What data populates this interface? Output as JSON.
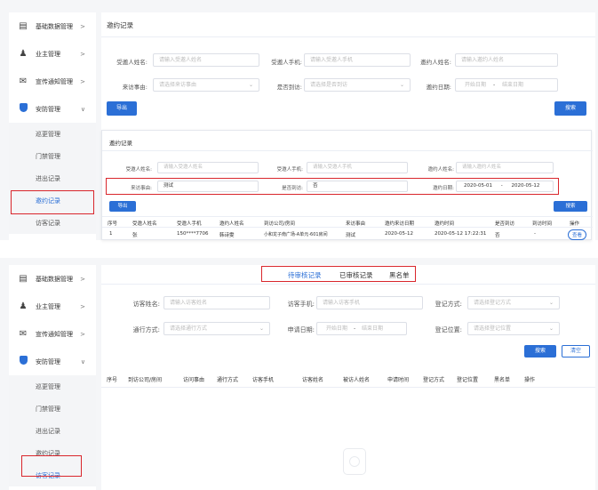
{
  "sidebar_top": {
    "items": [
      {
        "label": "基础数据管理",
        "icon": "document-icon",
        "arrow": ">"
      },
      {
        "label": "业主管理",
        "icon": "users-icon",
        "arrow": ">"
      },
      {
        "label": "宣传通知管理",
        "icon": "speaker-icon",
        "arrow": ">"
      },
      {
        "label": "安防管理",
        "icon": "shield-icon",
        "arrow": "∨"
      }
    ],
    "subitems": [
      "巡更管理",
      "门禁管理",
      "进出记录",
      "邀约记录",
      "访客记录"
    ]
  },
  "top_panel": {
    "title": "邀约记录",
    "labels": {
      "visitor_name": "受邀人姓名:",
      "visitor_phone": "受邀人手机:",
      "inviter_name": "邀约人姓名:",
      "reason": "来访事由:",
      "arrived": "是否到访:",
      "date": "邀约日期:"
    },
    "placeholders": {
      "visitor_name": "请输入受邀人姓名",
      "visitor_phone": "请输入受邀人手机",
      "inviter_name": "请输入邀约人姓名",
      "reason": "请选择来访事由",
      "arrived": "请选择是否到访",
      "date_start": "开始日期",
      "date_sep": "-",
      "date_end": "结束日期"
    },
    "export_button": "导出",
    "search_button": "搜索"
  },
  "inner_panel": {
    "title": "邀约记录",
    "labels": {
      "visitor_name": "受邀人姓名:",
      "visitor_phone": "受邀人手机:",
      "inviter_name": "邀约人姓名:",
      "reason": "来访事由:",
      "arrived": "是否到访:",
      "date": "邀约日期:"
    },
    "placeholders": {
      "visitor_name": "请输入受邀人姓名",
      "visitor_phone": "请输入受邀人手机",
      "inviter_name": "请输入邀约人姓名"
    },
    "values": {
      "reason": "测试",
      "arrived": "否",
      "date_start": "2020-05-01",
      "date_sep": "-",
      "date_end": "2020-05-12"
    },
    "export_button": "导出",
    "search_button": "搜索",
    "columns": [
      "序号",
      "受邀人姓名",
      "受邀人手机",
      "邀约人姓名",
      "到访公司/房间",
      "来访事由",
      "邀约来访日期",
      "邀约时间",
      "是否到访",
      "到访时间",
      "操作"
    ],
    "row": [
      "1",
      "张",
      "150****7706",
      "韩诗雯",
      "小和龙子南广场-A单元-601房间",
      "测试",
      "2020-05-12",
      "2020-05-12 17:22:31",
      "否",
      "-",
      "查看"
    ]
  },
  "sidebar_bottom": {
    "items": [
      {
        "label": "基础数据管理",
        "icon": "document-icon",
        "arrow": ">"
      },
      {
        "label": "业主管理",
        "icon": "users-icon",
        "arrow": ">"
      },
      {
        "label": "宣传通知管理",
        "icon": "speaker-icon",
        "arrow": ">"
      },
      {
        "label": "安防管理",
        "icon": "shield-icon",
        "arrow": "∨"
      }
    ],
    "subitems": [
      "巡更管理",
      "门禁管理",
      "进出记录",
      "邀约记录",
      "访客记录"
    ]
  },
  "bottom_panel": {
    "tabs": [
      "待审核记录",
      "已审核记录",
      "黑名单"
    ],
    "labels": {
      "visitor_name": "访客姓名:",
      "visitor_phone": "访客手机:",
      "reg_method": "登记方式:",
      "pass_method": "通行方式:",
      "apply_date": "申请日期:",
      "reg_location": "登记位置:"
    },
    "placeholders": {
      "visitor_name": "请输入访客姓名",
      "visitor_phone": "请输入访客手机",
      "reg_method": "请选择登记方式",
      "pass_method": "请选择通行方式",
      "date_start": "开始日期",
      "date_sep": "-",
      "date_end": "结束日期",
      "reg_location": "请选择登记位置"
    },
    "search_button": "搜索",
    "clear_button": "清空",
    "columns": [
      "序号",
      "到访公司/房间",
      "访问事由",
      "通行方式",
      "访客手机",
      "访客姓名",
      "被访人姓名",
      "申请时间",
      "登记方式",
      "登记位置",
      "黑名单",
      "操作"
    ]
  }
}
